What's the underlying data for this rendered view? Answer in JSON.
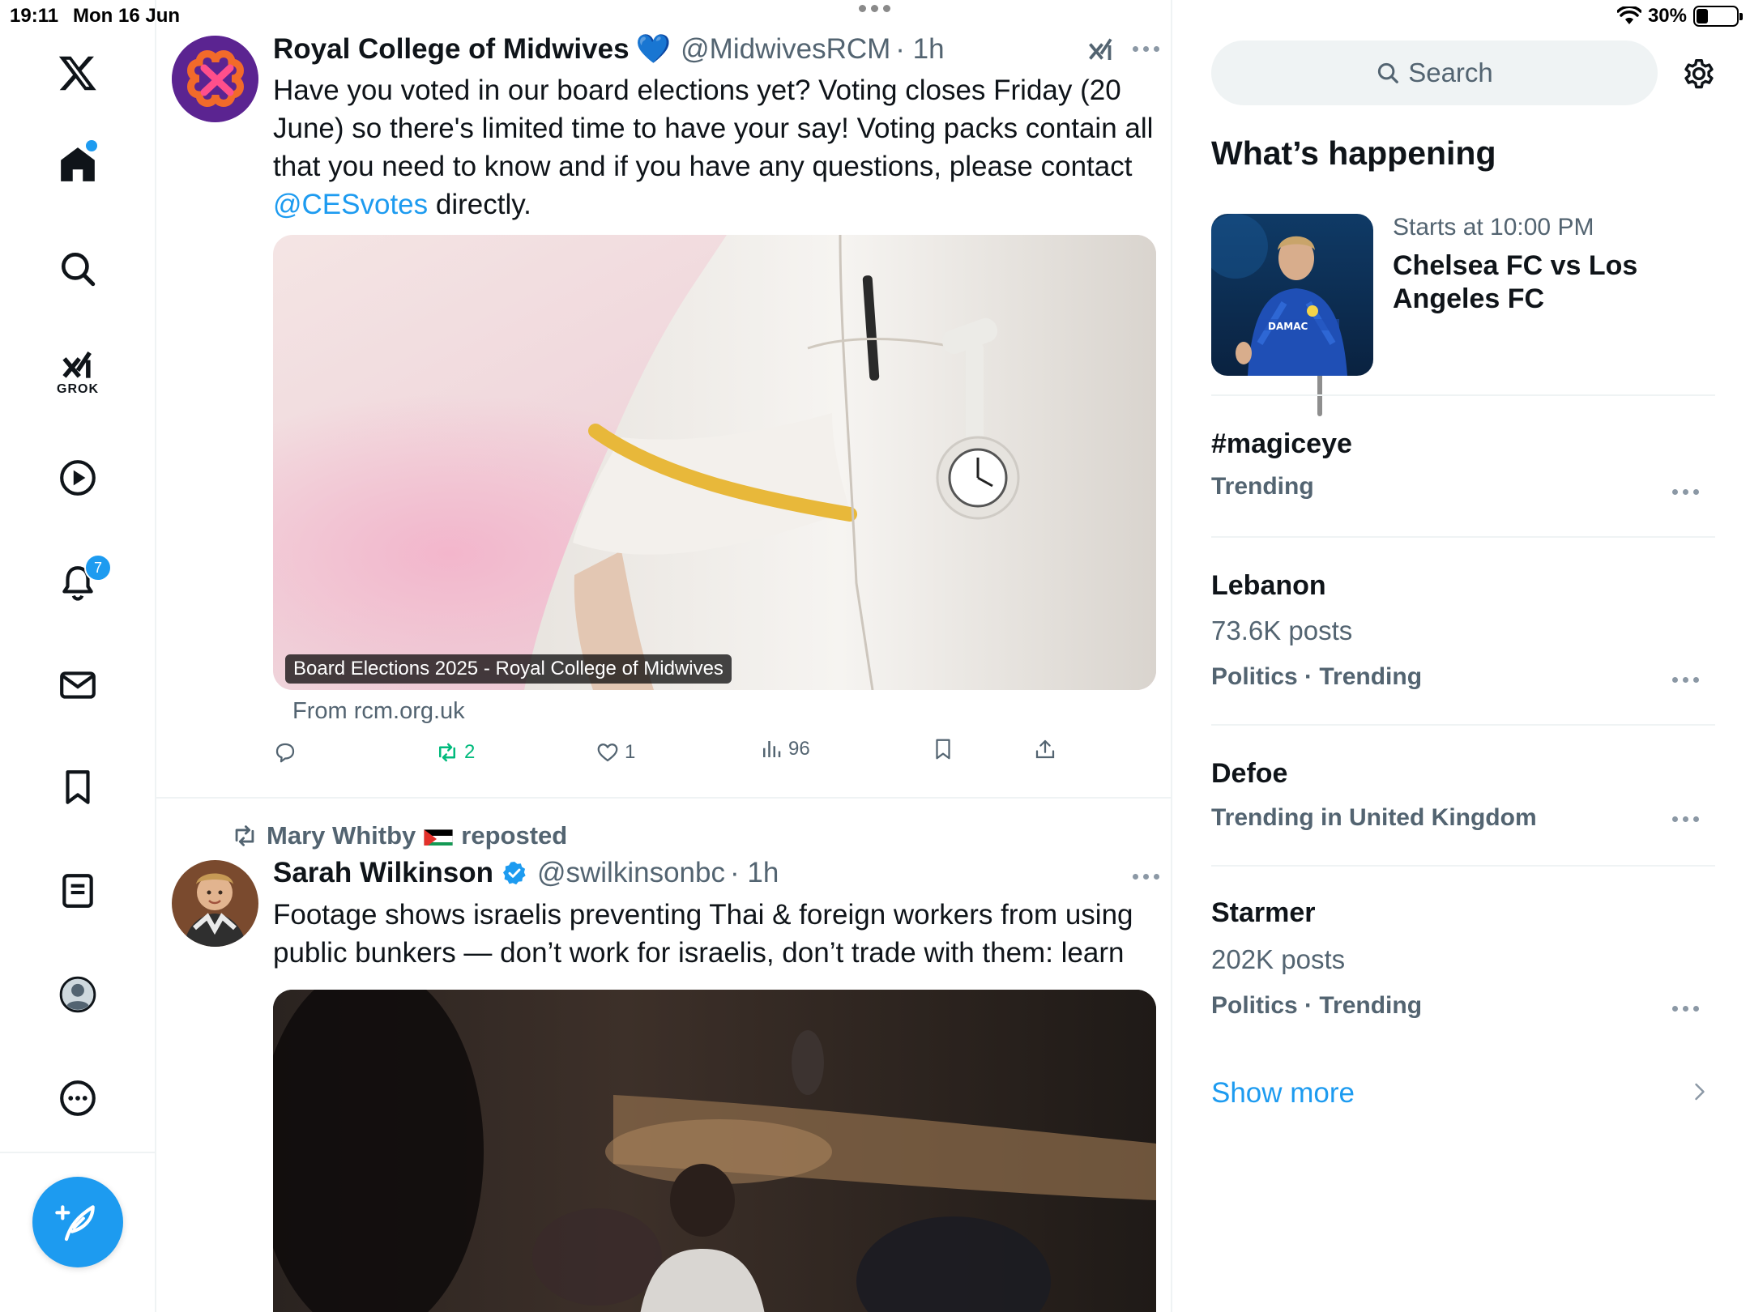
{
  "status_bar": {
    "time": "19:11",
    "date": "Mon 16 Jun",
    "battery": "30%",
    "battery_level": 0.3
  },
  "nav": {
    "logo": "x-logo-icon",
    "grok_label": "GROK",
    "notifications_badge": "7",
    "items": [
      "home-icon",
      "search-icon",
      "grok-icon",
      "video-icon",
      "notifications-icon",
      "messages-icon",
      "bookmarks-icon",
      "lists-icon",
      "profile-icon",
      "more-icon"
    ]
  },
  "tweets": [
    {
      "display_name": "Royal College of Midwives",
      "emoji": "💙",
      "handle": "@MidwivesRCM",
      "time": "· 1h",
      "text_before": "Have you voted in our board elections yet? Voting closes Friday (20 June) so there's limited time to have your say! Voting packs contain all that you need to know and if you have any questions, please contact",
      "mention": "@CESvotes",
      "text_after": "directly.",
      "card_caption": "Board Elections 2025 - Royal College of Midwives",
      "card_source": "From rcm.org.uk",
      "actions": {
        "replies": "",
        "reposts": "2",
        "likes": "1",
        "views": "96"
      }
    },
    {
      "repost_by": "Mary Whitby",
      "repost_label": "reposted",
      "display_name": "Sarah Wilkinson",
      "handle": "@swilkinsonbc",
      "time": "· 1h",
      "text": "Footage shows israelis preventing Thai & foreign workers from using public bunkers — don’t work for israelis, don’t trade with them: learn"
    }
  ],
  "sidebar": {
    "search_placeholder": "Search",
    "section_title": "What’s happening",
    "event": {
      "meta": "Starts at 10:00 PM",
      "title": "Chelsea FC vs Los Angeles FC",
      "shirt_text": "DAMAC"
    },
    "trends": [
      {
        "name": "#magiceye",
        "posts": "",
        "category": "Trending"
      },
      {
        "name": "Lebanon",
        "posts": "73.6K posts",
        "category": "Politics · Trending"
      },
      {
        "name": "Defoe",
        "posts": "",
        "category": "Trending in United Kingdom"
      },
      {
        "name": "Starmer",
        "posts": "202K posts",
        "category": "Politics · Trending"
      }
    ],
    "show_more": "Show more"
  },
  "colors": {
    "accent": "#1d9bf0",
    "text": "#0f1419",
    "secondary": "#536471",
    "repost_green": "#00ba7c",
    "divider": "#eff3f4"
  }
}
